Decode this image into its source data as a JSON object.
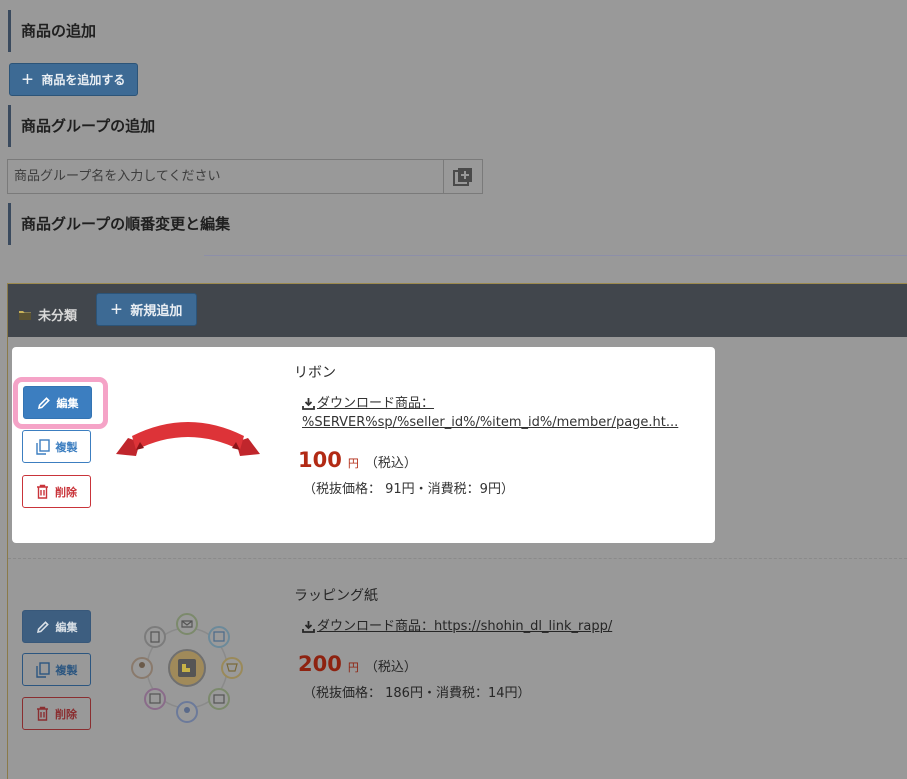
{
  "sections": {
    "add_item_title": "商品の追加",
    "add_item_button": "商品を追加する",
    "add_group_title": "商品グループの追加",
    "group_input_placeholder": "商品グループ名を入力してください",
    "reorder_title": "商品グループの順番変更と編集"
  },
  "group": {
    "name": "未分類",
    "new_button": "新規追加"
  },
  "actions": {
    "edit": "編集",
    "copy": "複製",
    "delete": "削除"
  },
  "items": [
    {
      "name": "リボン",
      "download_label": "ダウンロード商品：",
      "download_url": "%SERVER%sp/%seller_id%/%item_id%/member/page.ht...",
      "price": "100",
      "currency": "円",
      "tax_note": "（税込）",
      "detail": "（税抜価格： 91円・消費税：9円）"
    },
    {
      "name": "ラッピング紙",
      "download_text": "ダウンロード商品：https://shohin_dl_link_rapp/",
      "price": "200",
      "currency": "円",
      "tax_note": "（税込）",
      "detail": "（税抜価格： 186円・消費税：14円）"
    }
  ],
  "colors": {
    "overlay_bg": "#999999",
    "primary": "#3c7ec0",
    "danger": "#c9343a",
    "price": "#b22a14",
    "header": "#41464c",
    "highlight": "#f5a3c7"
  }
}
